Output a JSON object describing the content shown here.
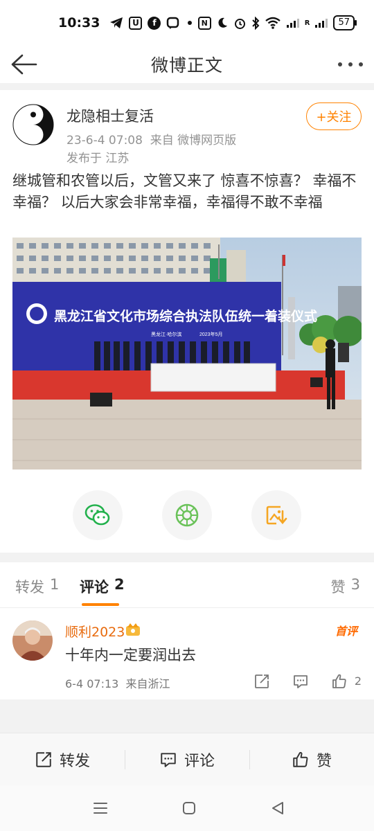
{
  "status_bar": {
    "time": "10:33",
    "battery": "57",
    "net": "R"
  },
  "nav": {
    "title": "微博正文"
  },
  "post": {
    "author": "龙隐相士复活",
    "meta": "23-6-4 07:08  来自 微博网页版",
    "location": "发布于 江苏",
    "follow_label": "+关注",
    "text": "继城管和农管以后，文管又来了 惊喜不惊喜？ 幸福不幸福？ 以后大家会非常幸福，幸福得不敢不幸福",
    "image": {
      "banner_main": "黑龙江省文化市场综合执法队伍统一着装仪式",
      "banner_sub1": "黑龙江·哈尔滨",
      "banner_sub2": "2023年5月"
    }
  },
  "share": {
    "icons": [
      "wechat-icon",
      "moments-icon",
      "save-image-icon"
    ]
  },
  "tabs": {
    "repost_label": "转发",
    "repost_count": "1",
    "comment_label": "评论",
    "comment_count": "2",
    "like_label": "赞",
    "like_count": "3"
  },
  "comment": {
    "name": "顺利2023",
    "tag": "首评",
    "text": "十年内一定要润出去",
    "meta": "6-4 07:13  来自浙江",
    "like_count": "2"
  },
  "actions": {
    "repost": "转发",
    "comment": "评论",
    "like": "赞"
  },
  "colors": {
    "accent": "#ff8200",
    "username": "#e86b0e",
    "wechat": "#22b14c",
    "moments": "#6ac259",
    "save": "#f5a623"
  }
}
